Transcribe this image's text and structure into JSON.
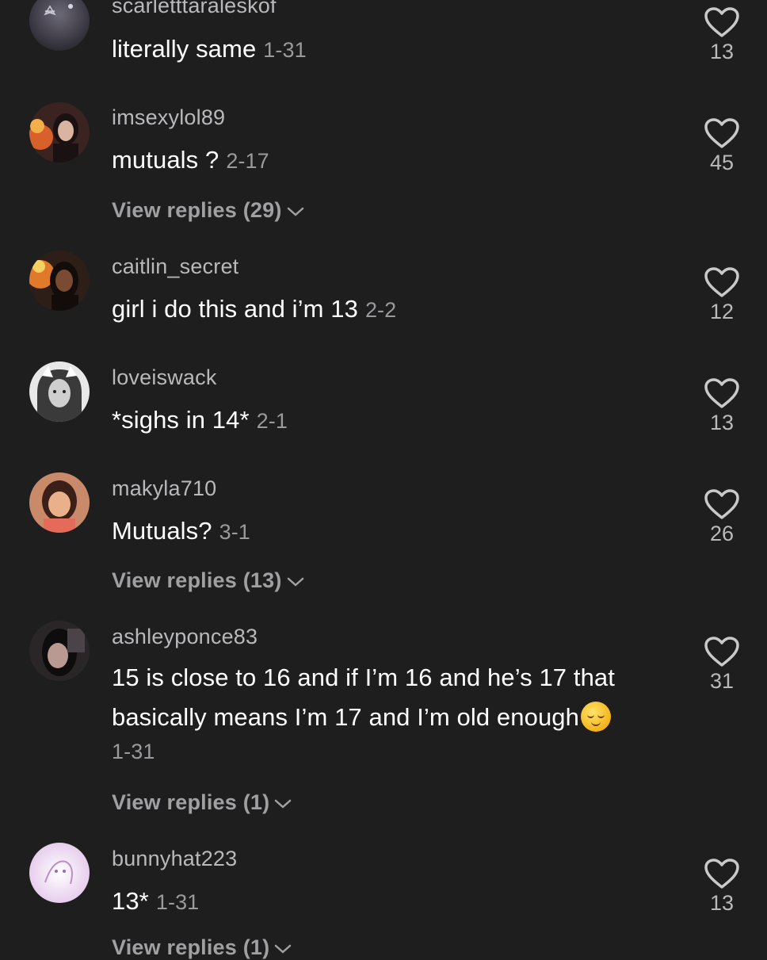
{
  "comments": [
    {
      "username": "scarletttaraleskof",
      "text": "literally same",
      "date": "1-31",
      "likes": "13"
    },
    {
      "username": "imsexylol89",
      "text": "mutuals ?",
      "date": "2-17",
      "likes": "45",
      "replies": "View replies (29)"
    },
    {
      "username": "caitlin_secret",
      "text": "girl i do this and i’m 13",
      "date": "2-2",
      "likes": "12"
    },
    {
      "username": "loveiswack",
      "text": "*sighs in 14*",
      "date": "2-1",
      "likes": "13"
    },
    {
      "username": "makyla710",
      "text": "Mutuals?",
      "date": "3-1",
      "likes": "26",
      "replies": "View replies (13)"
    },
    {
      "username": "ashleyponce83",
      "text": "15 is close to 16 and if I’m 16 and he’s 17 that basically means I’m 17 and I’m old enough",
      "emoji": "relieved-face-emoji",
      "date": "1-31",
      "likes": "31",
      "replies": "View replies (1)"
    },
    {
      "username": "bunnyhat223",
      "text": "13*",
      "date": "1-31",
      "likes": "13",
      "replies": "View replies (1)"
    }
  ],
  "icons": {
    "like": "heart-outline-icon",
    "expand": "chevron-down-icon"
  },
  "colors": {
    "background": "#1e1e1f",
    "text": "#ffffff",
    "secondary": "#b9b9bb"
  }
}
